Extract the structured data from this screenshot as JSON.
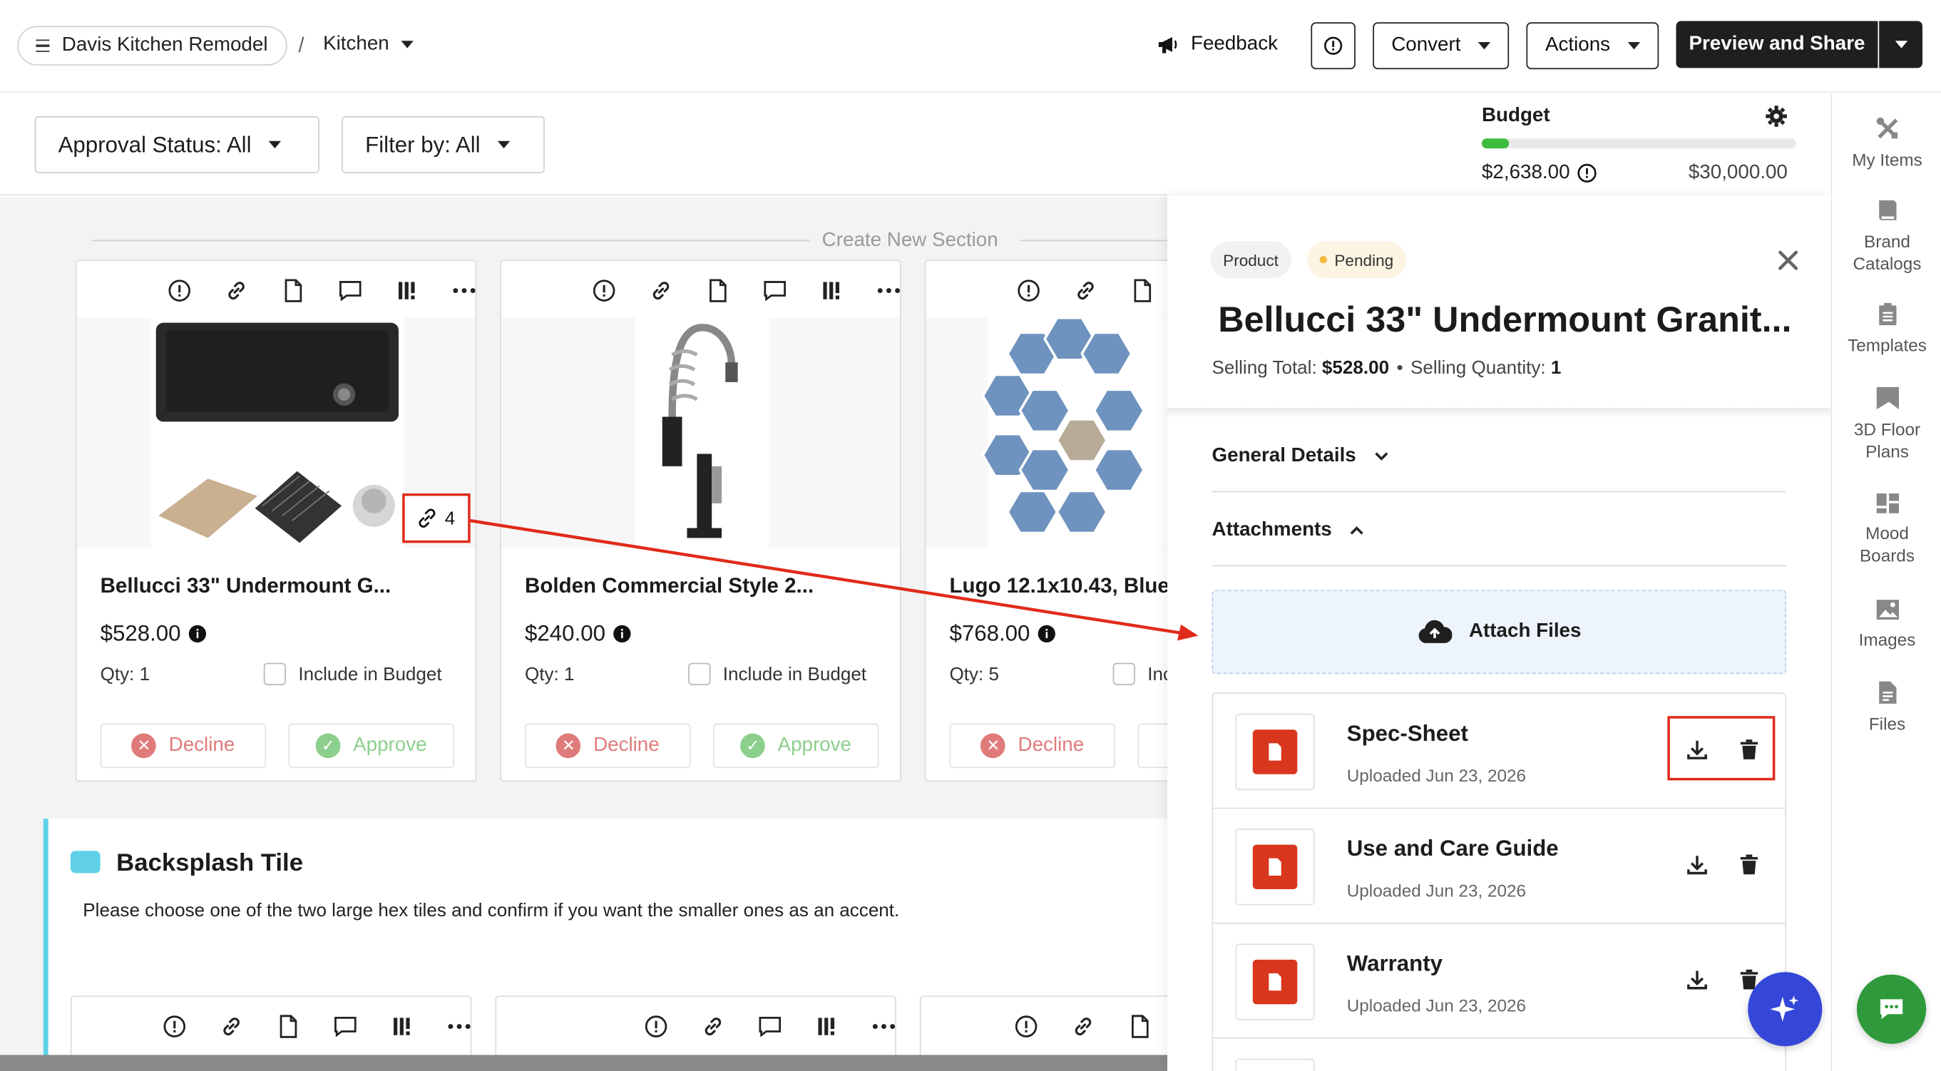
{
  "header": {
    "project_name": "Davis Kitchen Remodel",
    "separator": "/",
    "room": "Kitchen",
    "feedback_label": "Feedback",
    "convert_label": "Convert",
    "actions_label": "Actions",
    "preview_share_label": "Preview and Share"
  },
  "filters": {
    "approval_status": "Approval Status: All",
    "filter_by": "Filter by: All"
  },
  "canvas": {
    "create_section_label": "Create New Section"
  },
  "products": [
    {
      "title": "Bellucci 33\" Undermount G...",
      "price": "$528.00",
      "qty": "Qty: 1",
      "include_label": "Include in Budget",
      "decline_label": "Decline",
      "approve_label": "Approve",
      "attachment_count": "4"
    },
    {
      "title": "Bolden Commercial Style 2...",
      "price": "$240.00",
      "qty": "Qty: 1",
      "include_label": "Include in Budget",
      "decline_label": "Decline",
      "approve_label": "Approve"
    },
    {
      "title": "Lugo 12.1x10.43, Blue",
      "price": "$768.00",
      "qty": "Qty: 5",
      "include_label": "Inc",
      "decline_label": "Decline",
      "approve_label": ""
    }
  ],
  "section": {
    "title": "Backsplash Tile",
    "description": "Please choose one of the two large hex tiles and confirm if you want the smaller ones as an accent."
  },
  "budget": {
    "label": "Budget",
    "spent": "$2,638.00",
    "total": "$30,000.00",
    "progress_percent": 8.8
  },
  "detail_panel": {
    "type_tag": "Product",
    "status_tag": "Pending",
    "title": "Bellucci 33\" Undermount Granit...",
    "selling_total_label": "Selling Total: ",
    "selling_total_value": "$528.00",
    "dot": "•",
    "selling_qty_label": "Selling Quantity: ",
    "selling_qty_value": "1",
    "general_details_label": "General Details",
    "attachments_label": "Attachments",
    "attach_files_label": "Attach Files",
    "files": [
      {
        "name": "Spec-Sheet",
        "date": "Uploaded Jun 23, 2026"
      },
      {
        "name": "Use and Care Guide",
        "date": "Uploaded Jun 23, 2026"
      },
      {
        "name": "Warranty",
        "date": "Uploaded Jun 23, 2026"
      }
    ]
  },
  "sidebar": {
    "items": [
      {
        "label": "My Items",
        "icon": "tools-icon"
      },
      {
        "label": "Brand Catalogs",
        "icon": "book-icon"
      },
      {
        "label": "Templates",
        "icon": "clipboard-icon"
      },
      {
        "label": "3D Floor Plans",
        "icon": "floorplan-icon"
      },
      {
        "label": "Mood Boards",
        "icon": "moodboard-icon"
      },
      {
        "label": "Images",
        "icon": "image-icon"
      },
      {
        "label": "Files",
        "icon": "file-icon"
      }
    ]
  },
  "colors": {
    "accent_dark": "#1f1f1f",
    "pending_dot": "#f5b840",
    "budget_bar": "#3dbb3d",
    "decline": "#e07b7b",
    "approve": "#8ccf8c",
    "annotation_red": "#e02a1a",
    "pdf_red": "#d9361e",
    "ai_button": "#3447d8",
    "chat_button": "#2f9a3c",
    "section_accent": "#5fd0e8"
  }
}
